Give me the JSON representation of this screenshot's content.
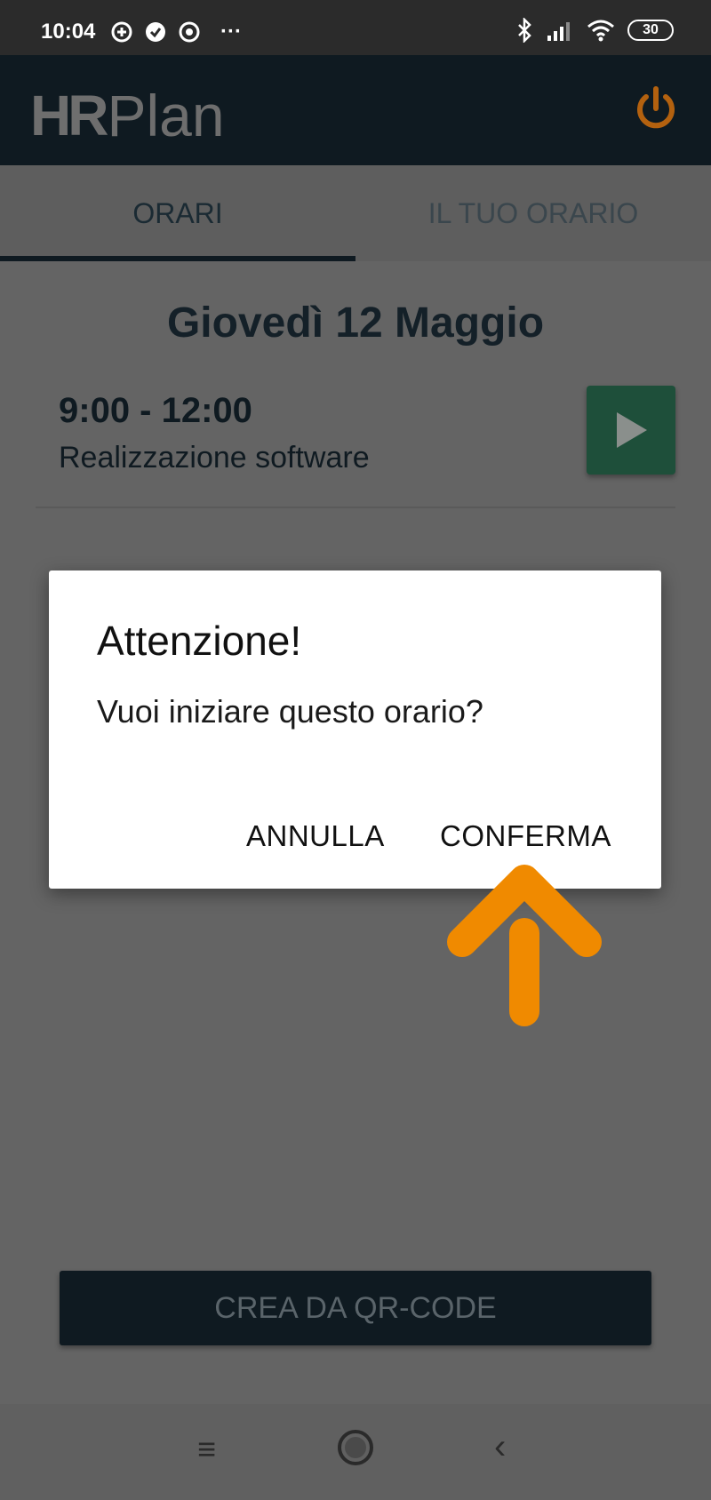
{
  "status_bar": {
    "time": "10:04",
    "more_indicator": "···",
    "battery_level": "30",
    "icons": [
      "data-saver-icon",
      "verified-icon",
      "chrome-icon",
      "bluetooth-icon",
      "signal-icon",
      "wifi-icon",
      "battery-icon"
    ]
  },
  "app_bar": {
    "logo_hr": "HR",
    "logo_plan": "Plan",
    "power_icon": "power-icon",
    "accent_color": "#b3610f"
  },
  "tabs": [
    {
      "label": "ORARI",
      "selected": true
    },
    {
      "label": "IL TUO ORARIO",
      "selected": false
    }
  ],
  "schedule": {
    "date": "Giovedì 12 Maggio",
    "shift_time": "9:00 - 12:00",
    "shift_description": "Realizzazione software",
    "play_icon": "play-icon"
  },
  "dialog": {
    "title": "Attenzione!",
    "message": "Vuoi iniziare questo orario?",
    "cancel_label": "ANNULLA",
    "confirm_label": "CONFERMA"
  },
  "annotation": {
    "arrow_color": "#f08a00",
    "icon": "up-arrow-icon"
  },
  "qr_button": {
    "label": "CREA DA QR-CODE"
  },
  "nav_bar": {
    "menu_glyph": "≡",
    "back_glyph": "‹"
  }
}
